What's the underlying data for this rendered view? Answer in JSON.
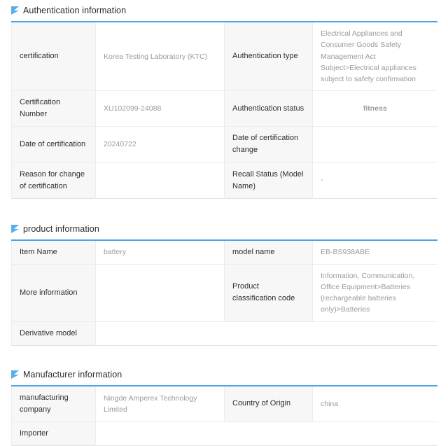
{
  "sections": [
    {
      "id": "authentication-information",
      "title": "Authentication information",
      "icon": "blue-flag-icon",
      "rows": [
        {
          "label_left": "certification",
          "value_left": "Korea Testing Laboratory (KTC)",
          "label_right": "Authentication type",
          "value_right": "Electrical Appliances and Consumer Goods Safety Management Act Subject>Electrical appliances subject to safety confirmation",
          "value_right_style": "normal"
        },
        {
          "label_left": "Certification Number",
          "value_left": "XU102099-24088",
          "label_right": "Authentication status",
          "value_right": "fitness",
          "value_right_style": "blue"
        },
        {
          "label_left": "Date of certification",
          "value_left": "20240722",
          "label_right": "Date of certification change",
          "value_right": "",
          "value_right_style": "normal"
        },
        {
          "label_left": "Reason for change of certification",
          "value_left": "",
          "label_right": "Recall Status (Model Name)",
          "value_right": "-",
          "value_right_style": "normal"
        }
      ]
    },
    {
      "id": "product-information",
      "title": "product information",
      "icon": "blue-flag-icon",
      "rows": [
        {
          "label_left": "Item Name",
          "value_left": "battery",
          "label_right": "model name",
          "value_right": "EB-BS938ABE",
          "value_right_style": "normal"
        },
        {
          "label_left": "More information",
          "value_left": "",
          "label_right": "Product classification code",
          "value_right": "Information, Communication, Office Equipment>Batteries (rechargeable batteries only)>Batteries",
          "value_right_style": "normal"
        }
      ],
      "full_row": {
        "label": "Derivative model",
        "value": ""
      }
    },
    {
      "id": "manufacturer-information",
      "title": "Manufacturer information",
      "icon": "blue-flag-icon",
      "rows": [
        {
          "label_left": "manufacturing company",
          "value_left": "Ningde Amperex Technology Limited",
          "label_right": "Country of Origin",
          "value_right": "china",
          "value_right_style": "normal"
        }
      ],
      "full_row": {
        "label": "Importer",
        "value": ""
      }
    }
  ],
  "colors": {
    "accent_border": "#49a5e6",
    "label_bg": "#f7f7f7",
    "value_text": "#9a9a9a",
    "status_blue": "#3c8ddc",
    "grid_line": "#ececec"
  }
}
